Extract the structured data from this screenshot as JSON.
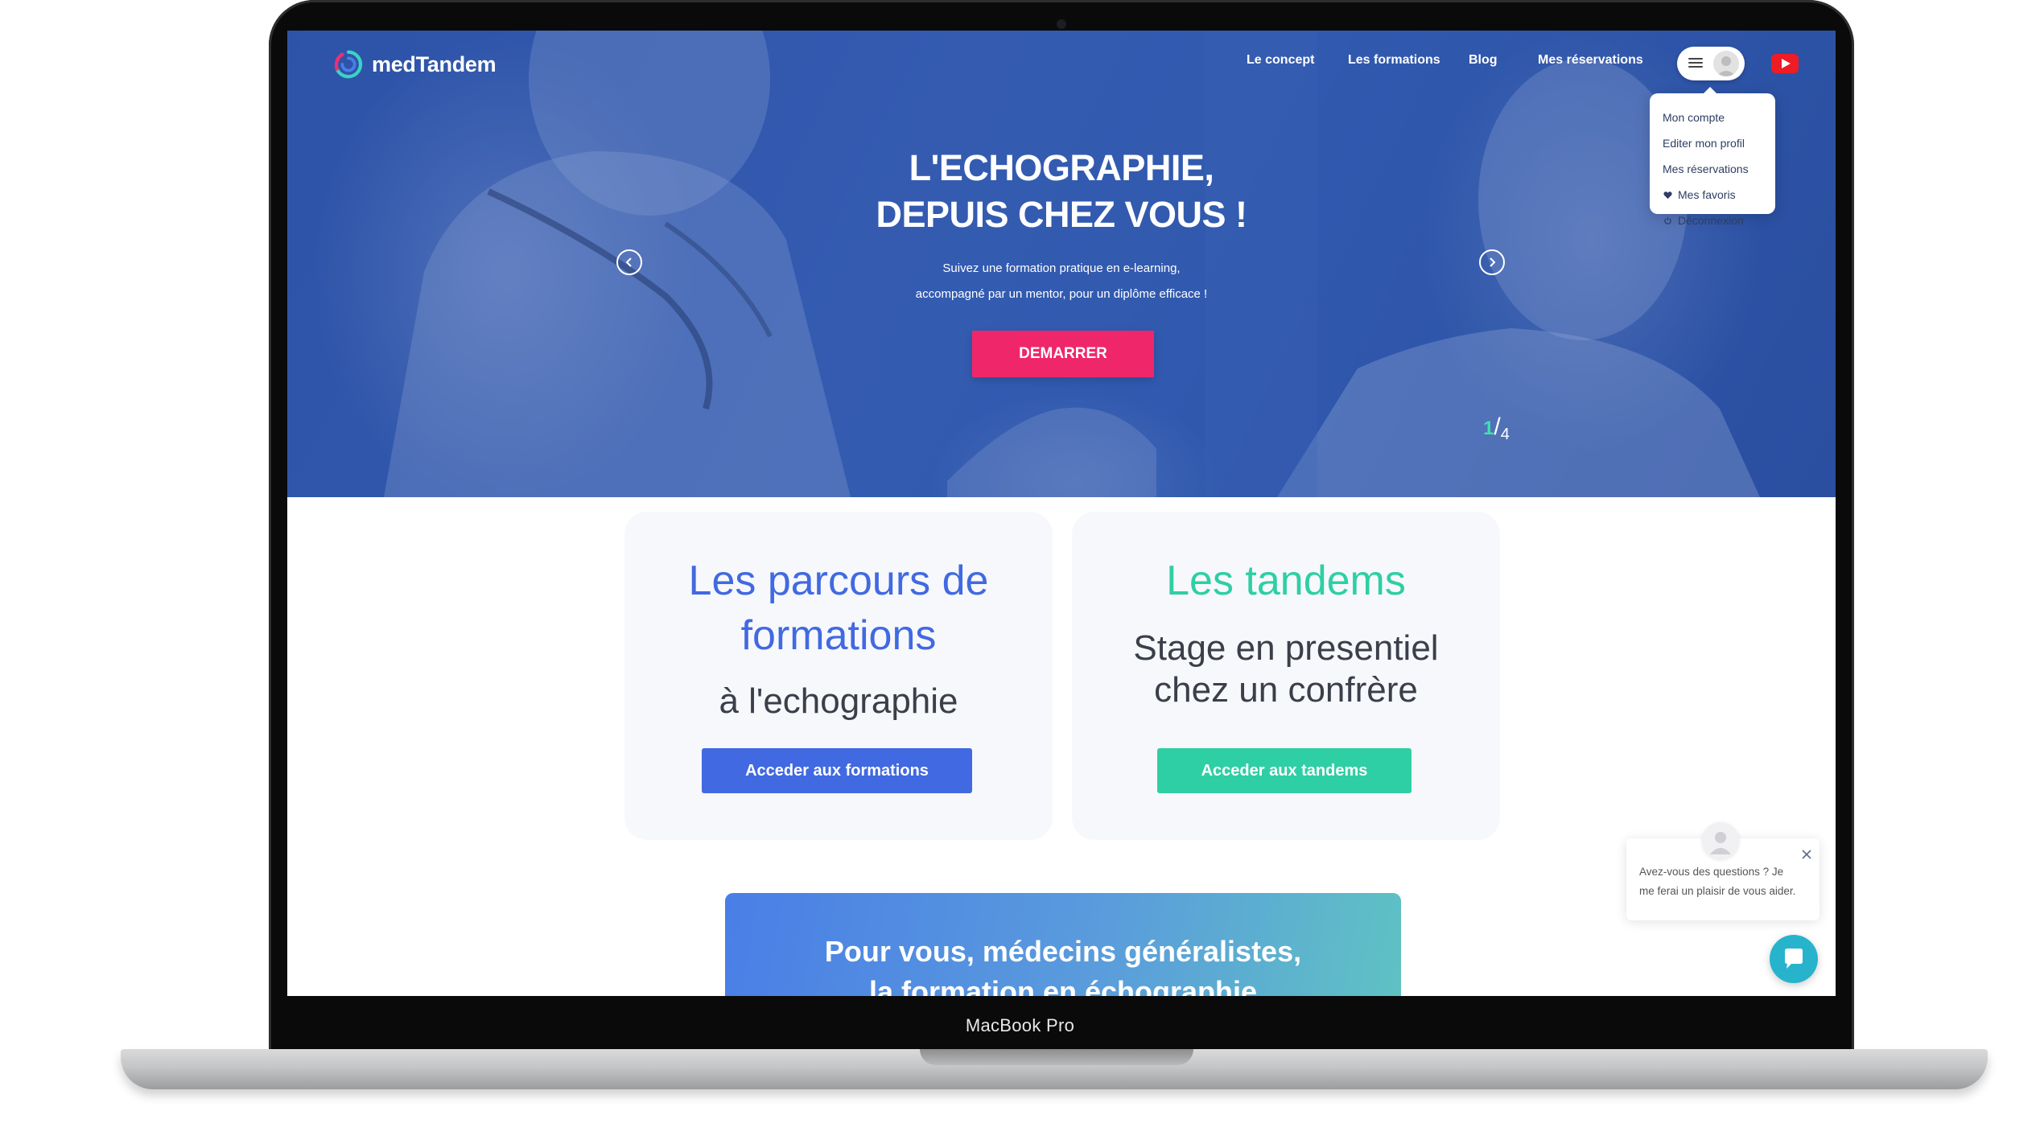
{
  "device": {
    "label": "MacBook Pro"
  },
  "header": {
    "brand": "medTandem",
    "nav": [
      "Le concept",
      "Les formations",
      "Blog",
      "Mes réservations"
    ]
  },
  "user_menu": {
    "items": [
      "Mon compte",
      "Editer mon profil",
      "Mes réservations",
      "Mes favoris",
      "Déconnexion"
    ]
  },
  "hero": {
    "title_line1": "L'ECHOGRAPHIE,",
    "title_line2": "DEPUIS CHEZ VOUS !",
    "subtitle_line1": "Suivez une formation pratique en e-learning,",
    "subtitle_line2": "accompagné par un mentor, pour un diplôme efficace !",
    "cta": "DEMARRER",
    "slide_current": "1",
    "slide_separator": "/",
    "slide_total": "4"
  },
  "cards": {
    "formations": {
      "title_line1": "Les parcours de",
      "title_line2": "formations",
      "subtitle": "à l'echographie",
      "button": "Acceder aux formations"
    },
    "tandems": {
      "title": "Les tandems",
      "subtitle_line1": "Stage en presentiel",
      "subtitle_line2": "chez un confrère",
      "button": "Acceder aux tandems"
    }
  },
  "banner": {
    "line1": "Pour vous, médecins généralistes,",
    "line2": "la formation en échographie"
  },
  "chat": {
    "line1": "Avez-vous des questions ? Je",
    "line2": "me ferai un plaisir de vous aider."
  },
  "colors": {
    "hero_blue": "#3560b3",
    "cta_pink": "#f0266a",
    "formations_blue": "#4169e1",
    "tandems_green": "#2ecfa4",
    "chat_teal": "#27b3cc",
    "youtube_red": "#ee1c24"
  },
  "icons": [
    "logo-icon",
    "menu-icon",
    "avatar-icon",
    "youtube-icon",
    "arrow-left-icon",
    "arrow-right-icon",
    "heart-icon",
    "power-icon",
    "close-icon",
    "chat-icon"
  ]
}
